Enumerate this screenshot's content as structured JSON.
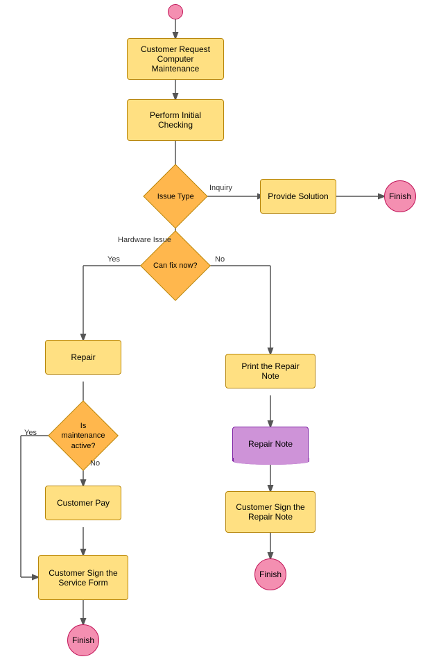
{
  "nodes": {
    "start": {
      "label": ""
    },
    "request": {
      "label": "Customer Request\nComputer Maintenance"
    },
    "initial_check": {
      "label": "Perform Initial Checking"
    },
    "issue_type": {
      "label": "Issue Type"
    },
    "provide_solution": {
      "label": "Provide Solution"
    },
    "finish_top": {
      "label": "Finish"
    },
    "can_fix": {
      "label": "Can fix now?"
    },
    "repair": {
      "label": "Repair"
    },
    "print_repair": {
      "label": "Print the Repair Note"
    },
    "repair_note": {
      "label": "Repair Note"
    },
    "is_maintenance": {
      "label": "Is\nmaintenance\nactive?"
    },
    "customer_pay": {
      "label": "Customer Pay"
    },
    "customer_sign_repair": {
      "label": "Customer Sign the Repair\nNote"
    },
    "customer_sign_service": {
      "label": "Customer Sign the Service\nForm"
    },
    "finish_right": {
      "label": "Finish"
    },
    "finish_bottom": {
      "label": "Finish"
    }
  },
  "labels": {
    "inquiry": "Inquiry",
    "hardware": "Hardware Issue",
    "yes_fix": "Yes",
    "no_fix": "No",
    "yes_maint": "Yes",
    "no_maint": "No"
  }
}
